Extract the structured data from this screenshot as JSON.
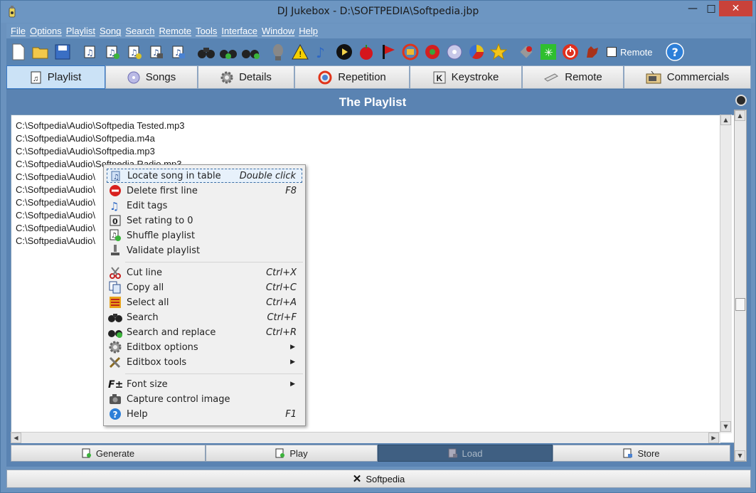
{
  "window": {
    "title": "DJ Jukebox - D:\\SOFTPEDIA\\Softpedia.jbp"
  },
  "menu": [
    "File",
    "Options",
    "Playlist",
    "Song",
    "Search",
    "Remote",
    "Tools",
    "Interface",
    "Window",
    "Help"
  ],
  "toolbar": {
    "remote_label": "Remote"
  },
  "tabs": [
    {
      "label": "Playlist",
      "icon": "music-note-icon"
    },
    {
      "label": "Songs",
      "icon": "disc-icon"
    },
    {
      "label": "Details",
      "icon": "gear-icon"
    },
    {
      "label": "Repetition",
      "icon": "repeat-icon"
    },
    {
      "label": "Keystroke",
      "icon": "key-icon"
    },
    {
      "label": "Remote",
      "icon": "remote-icon"
    },
    {
      "label": "Commercials",
      "icon": "tv-icon"
    }
  ],
  "panel": {
    "title": "The Playlist"
  },
  "playlist_lines": [
    "C:\\Softpedia\\Audio\\Softpedia Tested.mp3",
    "C:\\Softpedia\\Audio\\Softpedia.m4a",
    "C:\\Softpedia\\Audio\\Softpedia.mp3",
    "C:\\Softpedia\\Audio\\Softpedia Radio.mp3",
    "C:\\Softpedia\\Audio\\",
    "C:\\Softpedia\\Audio\\",
    "C:\\Softpedia\\Audio\\",
    "C:\\Softpedia\\Audio\\",
    "C:\\Softpedia\\Audio\\",
    "C:\\Softpedia\\Audio\\"
  ],
  "context_menu": {
    "group1": [
      {
        "label": "Locate song in table",
        "shortcut": "Double click",
        "icon": "locate-icon"
      },
      {
        "label": "Delete first line",
        "shortcut": "F8",
        "icon": "delete-icon"
      },
      {
        "label": "Edit tags",
        "shortcut": "",
        "icon": "edit-tags-icon"
      },
      {
        "label": "Set rating to 0",
        "shortcut": "",
        "icon": "rating-icon"
      },
      {
        "label": "Shuffle playlist",
        "shortcut": "",
        "icon": "shuffle-icon"
      },
      {
        "label": "Validate playlist",
        "shortcut": "",
        "icon": "validate-icon"
      }
    ],
    "group2": [
      {
        "label": "Cut line",
        "shortcut": "Ctrl+X",
        "icon": "scissors-icon"
      },
      {
        "label": "Copy all",
        "shortcut": "Ctrl+C",
        "icon": "copy-icon"
      },
      {
        "label": "Select all",
        "shortcut": "Ctrl+A",
        "icon": "select-all-icon"
      },
      {
        "label": "Search",
        "shortcut": "Ctrl+F",
        "icon": "binoculars-icon"
      },
      {
        "label": "Search and replace",
        "shortcut": "Ctrl+R",
        "icon": "replace-icon"
      },
      {
        "label": "Editbox options",
        "shortcut": "",
        "icon": "gear-icon"
      },
      {
        "label": "Editbox tools",
        "shortcut": "",
        "icon": "tools-icon"
      }
    ],
    "group3": [
      {
        "label": "Font size",
        "shortcut": "",
        "icon": "font-size-icon"
      },
      {
        "label": "Capture control image",
        "shortcut": "",
        "icon": "camera-icon"
      },
      {
        "label": "Help",
        "shortcut": "F1",
        "icon": "help-icon"
      }
    ]
  },
  "buttons": [
    {
      "label": "Generate"
    },
    {
      "label": "Play"
    },
    {
      "label": "Load"
    },
    {
      "label": "Store"
    }
  ],
  "status": {
    "label": "Softpedia"
  }
}
